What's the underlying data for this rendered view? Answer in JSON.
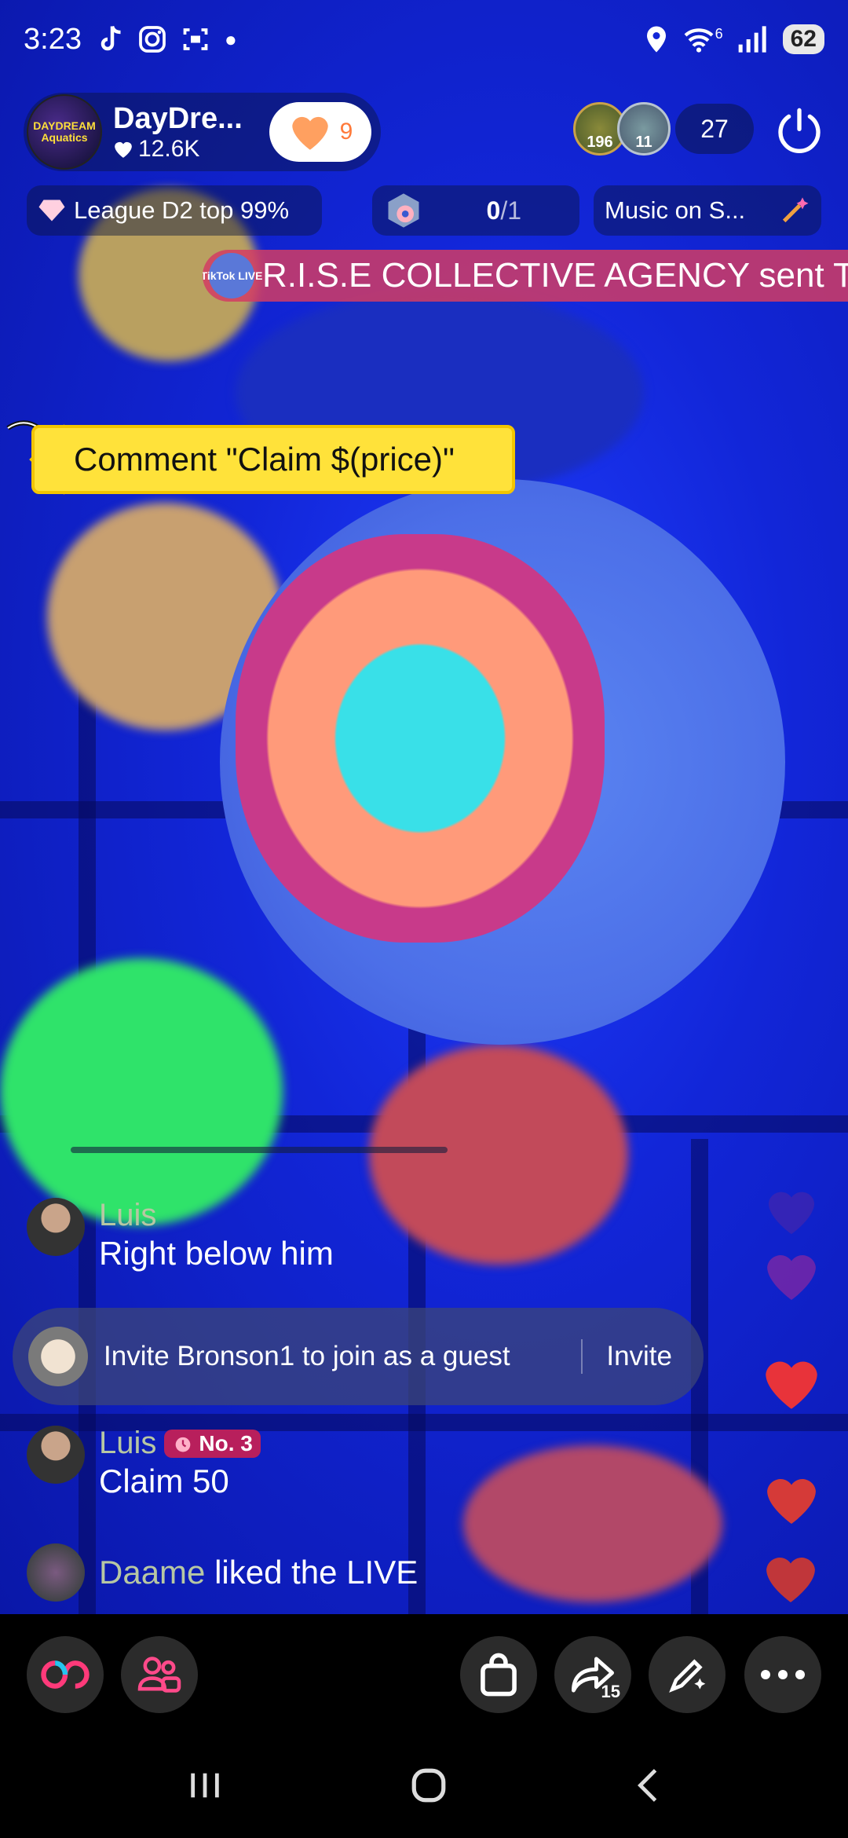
{
  "status_bar": {
    "time": "3:23",
    "wifi_label": "6",
    "battery": "62"
  },
  "host": {
    "name": "DayDre...",
    "likes": "12.6K",
    "follow_count": "9",
    "avatar_text": "DAYDREAM Aquatics"
  },
  "viewers": {
    "top1_score": "196",
    "top2_score": "11",
    "count": "27"
  },
  "info_row": {
    "league": "League D2 top 99%",
    "goal_progress": "0",
    "goal_total": "/1",
    "music": "Music on S..."
  },
  "gift_banner": {
    "icon_text": "TikTok LIVE",
    "text": "R.I.S.E COLLECTIVE AGENCY sent T"
  },
  "price_tag": {
    "text": "Comment \"Claim $(price)\""
  },
  "comments": [
    {
      "user": "Luis",
      "text": "Right below him"
    },
    {
      "user": "Luis",
      "badge": "No. 3",
      "text": "Claim 50"
    },
    {
      "user": "Daame",
      "text": "liked the LIVE"
    }
  ],
  "invite": {
    "text": "Invite Bronson1 to join as a guest",
    "button": "Invite"
  },
  "toolbar": {
    "share_count": "15"
  },
  "colors": {
    "accent_pink": "#ff2d7a",
    "accent_cyan": "#25f4ee",
    "heart_red": "#e8333a",
    "follow_orange": "#ff7a3a",
    "tag_yellow": "#ffe23a"
  }
}
